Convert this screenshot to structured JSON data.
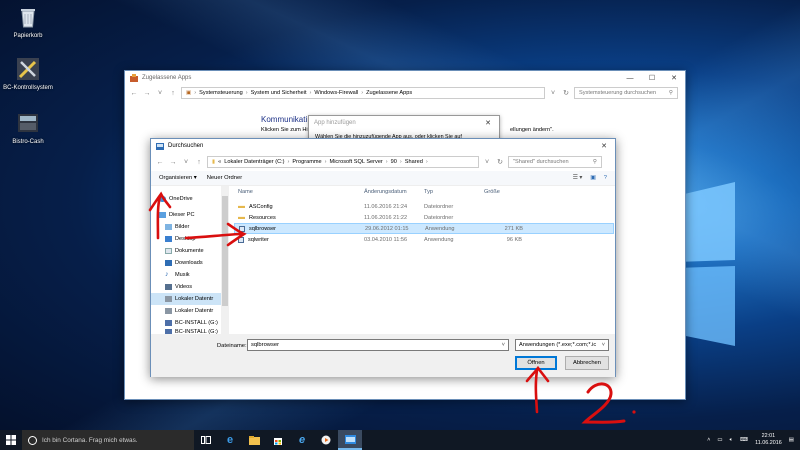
{
  "desktop": {
    "icons": [
      {
        "label": "Papierkorb"
      },
      {
        "label": "BC-Kontrollsystem"
      },
      {
        "label": "Bistro-Cash"
      }
    ]
  },
  "back_window": {
    "title": "Zugelassene Apps",
    "breadcrumb": [
      "Systemsteuerung",
      "System und Sicherheit",
      "Windows-Firewall",
      "Zugelassene Apps"
    ],
    "search_placeholder": "Systemsteuerung durchsuchen",
    "heading_partial": "Kommunikati",
    "line_partial": "Klicken Sie zum Hi",
    "line_right_partial": "ellungen ändern\"."
  },
  "app_dialog": {
    "title": "App hinzufügen",
    "text_partial": "Wählen Sie die hinzuzufügende App aus, oder klicken Sie auf"
  },
  "browse_dialog": {
    "title": "Durchsuchen",
    "path_prefix": "«",
    "breadcrumb": [
      "Lokaler Datenträger (C:)",
      "Programme",
      "Microsoft SQL Server",
      "90",
      "Shared"
    ],
    "search_placeholder": "\"Shared\" durchsuchen",
    "organize_label": "Organisieren ▾",
    "new_folder_label": "Neuer Ordner",
    "nav_items": [
      {
        "label": "OneDrive",
        "icon": "cloud-icon"
      },
      {
        "label": "Dieser PC",
        "icon": "pc-icon"
      },
      {
        "label": "Bilder",
        "icon": "pictures-icon"
      },
      {
        "label": "Desktop",
        "icon": "desktop-icon"
      },
      {
        "label": "Dokumente",
        "icon": "documents-icon"
      },
      {
        "label": "Downloads",
        "icon": "download-icon"
      },
      {
        "label": "Musik",
        "icon": "music-icon"
      },
      {
        "label": "Videos",
        "icon": "video-icon"
      },
      {
        "label": "Lokaler Datentr",
        "icon": "drive-icon"
      },
      {
        "label": "Lokaler Datentr",
        "icon": "drive-icon"
      },
      {
        "label": "BC-INSTALL (G:)",
        "icon": "usb-drive-icon"
      },
      {
        "label": "BC-INSTALL (G:)",
        "icon": "usb-drive-icon"
      }
    ],
    "columns": {
      "name": "Name",
      "date": "Änderungsdatum",
      "type": "Typ",
      "size": "Größe"
    },
    "files": [
      {
        "name": "ASConfig",
        "date": "11.06.2016 21:24",
        "type": "Dateiordner",
        "size": "",
        "icon": "folder-icon"
      },
      {
        "name": "Resources",
        "date": "11.06.2016 21:22",
        "type": "Dateiordner",
        "size": "",
        "icon": "folder-icon"
      },
      {
        "name": "sqlbrowser",
        "date": "29.06.2012 01:15",
        "type": "Anwendung",
        "size": "271 KB",
        "icon": "application-icon"
      },
      {
        "name": "sqlwriter",
        "date": "03.04.2010 11:56",
        "type": "Anwendung",
        "size": "96 KB",
        "icon": "application-icon"
      }
    ],
    "filename_label": "Dateiname:",
    "filename_value": "sqlbrowser",
    "filetype_value": "Anwendungen (*.exe;*.com;*.ic",
    "open_label": "Öffnen",
    "cancel_label": "Abbrechen"
  },
  "annotations": {
    "step_two": "2."
  },
  "taskbar": {
    "search_text": "Ich bin Cortana. Frag mich etwas.",
    "time": "22:01",
    "date": "11.06.2016"
  }
}
